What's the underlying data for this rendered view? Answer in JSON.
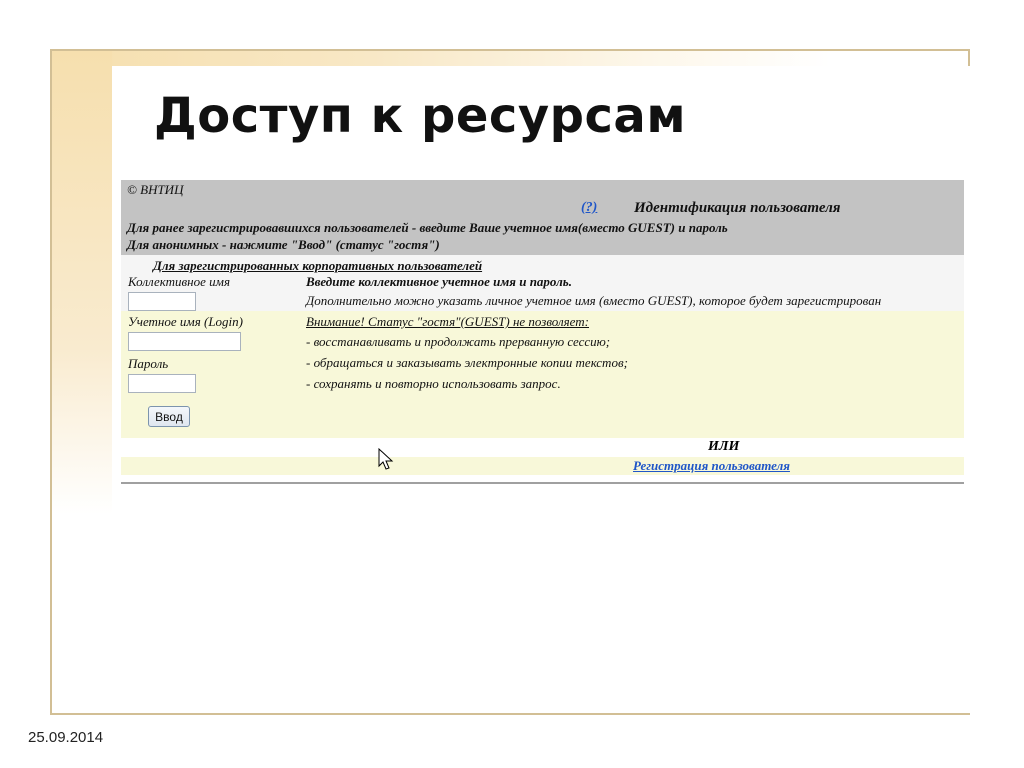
{
  "slide": {
    "title": "Доступ к ресурсам",
    "date": "25.09.2014"
  },
  "header": {
    "copyright": "© ВНТИЦ",
    "help_link": "(?)",
    "title": "Идентификация пользователя",
    "line1": "Для ранее зарегистрировавшихся пользователей - введите Ваше учетное имя(вместо GUEST) и пароль",
    "line2": "Для анонимных - нажмите \"Ввод\" (статус \"гостя\")"
  },
  "corporate": {
    "heading": "Для зарегистрированных корпоративных пользователей",
    "collective_label": "Коллективное имя",
    "instruction": "Введите коллективное учетное имя и пароль.",
    "note": "Дополнительно можно указать личное учетное имя (вместо GUEST), которое будет зарегистрирован",
    "collective_value": ""
  },
  "login": {
    "login_label": "Учетное имя (Login)",
    "login_value": "",
    "password_label": "Пароль",
    "password_value": "",
    "warning_heading": "Внимание! Статус \"гостя\"(GUEST) не позволяет:",
    "warnings": [
      "- восстанавливать и продолжать прерванную сессию;",
      "- обращаться и заказывать электронные копии текстов;",
      "- сохранять и повторно использовать запрос."
    ],
    "submit_label": "Ввод"
  },
  "alternative": {
    "or_label": "ИЛИ",
    "register_link": "Регистрация пользователя"
  },
  "colors": {
    "link": "#1f56c8",
    "header_bg": "#c3c3c3",
    "login_bg": "#f8f8d9",
    "frame": "#d2bf95"
  }
}
